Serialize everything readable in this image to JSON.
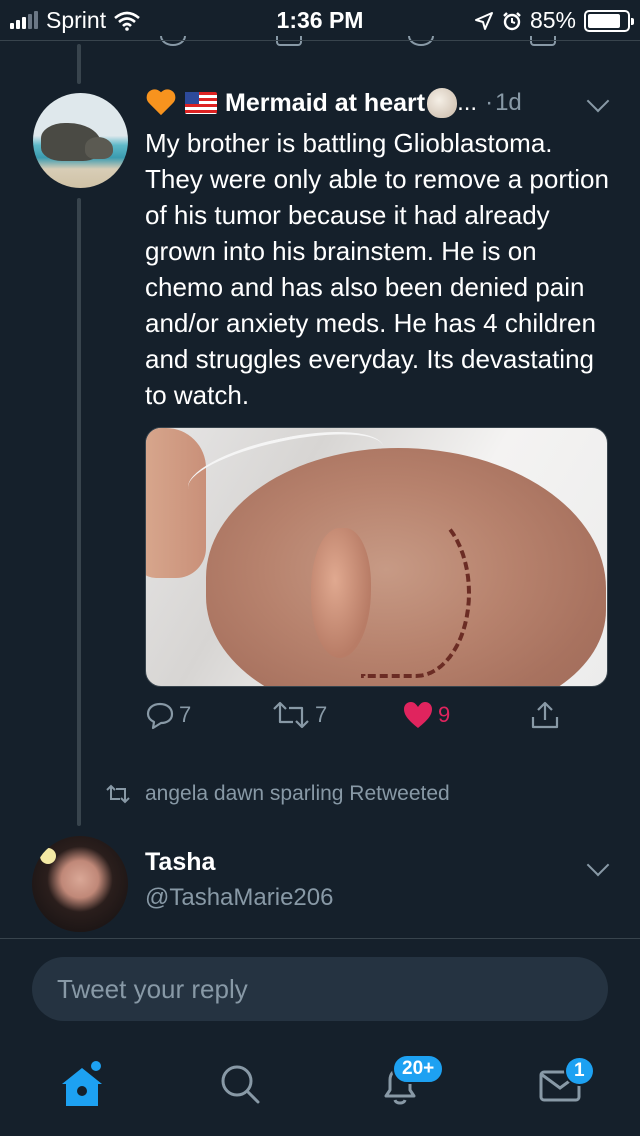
{
  "status_bar": {
    "carrier": "Sprint",
    "time": "1:36 PM",
    "battery_percent": "85%",
    "battery_level": 0.85
  },
  "tweet": {
    "display_name": "Mermaid at heart",
    "name_truncation": "...",
    "dot": "·",
    "time_ago": "1d",
    "text": "My brother is battling Glioblastoma. They were only able to remove a portion of his tumor because it had already grown into his brainstem. He is on chemo and has also been denied pain and/or anxiety meds. He has 4 children and struggles everyday. Its devastating to watch.",
    "reply_count": "7",
    "retweet_count": "7",
    "like_count": "9",
    "like_color": "#e0245e"
  },
  "retweet_note": {
    "text": "angela dawn sparling Retweeted"
  },
  "user": {
    "name": "Tasha",
    "handle": "@TashaMarie206"
  },
  "reply": {
    "placeholder": "Tweet your reply"
  },
  "tab_bar": {
    "notifications_badge": "20+",
    "messages_badge": "1",
    "accent_color": "#1da1f2"
  },
  "colors": {
    "background": "#15202b",
    "secondary_text": "#8899a6"
  }
}
